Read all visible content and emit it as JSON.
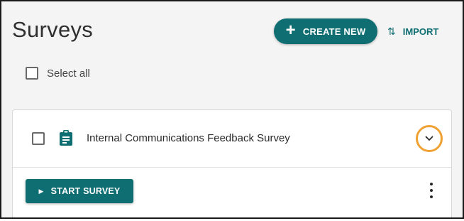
{
  "header": {
    "title": "Surveys",
    "create_label": "CREATE NEW",
    "create_icon": "plus-icon",
    "import_label": "IMPORT",
    "import_icon": "swap-vertical-icon"
  },
  "selection": {
    "select_all_label": "Select all",
    "select_all_checked": false
  },
  "surveys": [
    {
      "title": "Internal Communications Feedback Survey",
      "icon": "clipboard-icon",
      "checked": false,
      "expanded": true,
      "start_label": "START SURVEY",
      "start_icon": "play-icon",
      "more_icon": "more-vertical-icon"
    }
  ],
  "colors": {
    "accent": "#0f6e72",
    "highlight_ring": "#f0a133",
    "background": "#f4f4f4"
  }
}
